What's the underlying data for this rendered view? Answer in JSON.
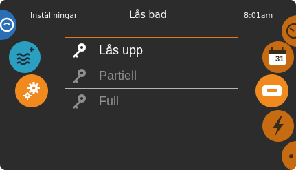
{
  "header": {
    "left_label": "Inställningar",
    "title": "Lås bad",
    "time": "8:01am"
  },
  "menu": {
    "items": [
      {
        "label": "Lås upp",
        "icon": "key-icon",
        "state": "selected"
      },
      {
        "label": "Partiell",
        "icon": "key-icon",
        "state": "unselected"
      },
      {
        "label": "Full",
        "icon": "key-icon",
        "state": "unselected"
      }
    ]
  },
  "left_nav": [
    {
      "icon": "spa-icon",
      "color": "#2a6fb5"
    },
    {
      "icon": "water-temperature-icon",
      "color": "#2a9fc0"
    },
    {
      "icon": "settings-gears-icon",
      "color": "#f08a1e"
    }
  ],
  "right_nav": [
    {
      "icon": "clock-icon",
      "color": "#c76b12"
    },
    {
      "icon": "calendar-icon",
      "calendar_text": "31",
      "color": "#c76b12"
    },
    {
      "icon": "display-icon",
      "color": "#f08a1e"
    },
    {
      "icon": "lightning-icon",
      "color": "#c76b12"
    },
    {
      "icon": "more-icon",
      "color": "#c76b12"
    }
  ],
  "colors": {
    "background": "#2c2c2c",
    "accent": "#e07a1a",
    "active_text": "#ffffff",
    "inactive_text": "#8e8e8e"
  }
}
